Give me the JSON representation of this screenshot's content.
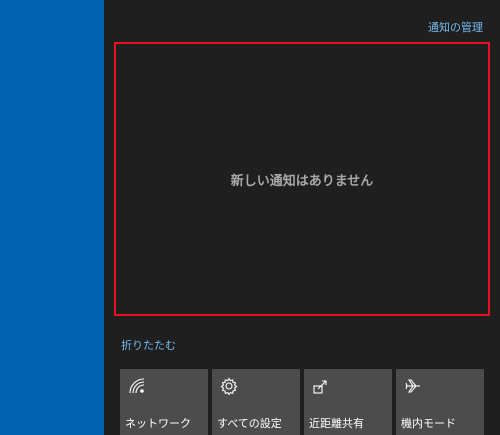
{
  "action_center": {
    "manage_link": "通知の管理",
    "empty_message": "新しい通知はありません",
    "collapse_link": "折りたたむ",
    "highlight_color": "#e81123",
    "link_color": "#76b9ed",
    "quick_actions": [
      {
        "label": "ネットワーク",
        "icon": "network-icon"
      },
      {
        "label": "すべての設定",
        "icon": "gear-icon"
      },
      {
        "label": "近距離共有",
        "icon": "nearby-share-icon"
      },
      {
        "label": "機内モード",
        "icon": "airplane-icon"
      }
    ]
  },
  "desktop": {
    "background_color": "#0063b1"
  }
}
